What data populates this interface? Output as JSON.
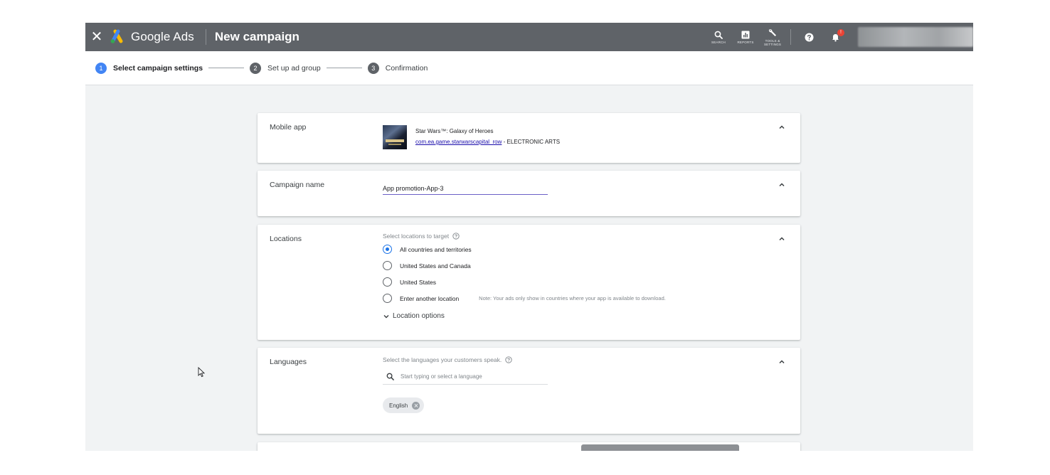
{
  "header": {
    "brand": "Google Ads",
    "page_title": "New campaign",
    "tools": [
      {
        "label": "SEARCH",
        "icon": "search-icon"
      },
      {
        "label": "REPORTS",
        "icon": "reports-icon"
      },
      {
        "label": "TOOLS & SETTINGS",
        "icon": "wrench-icon"
      }
    ],
    "notification_badge": "!"
  },
  "stepper": {
    "steps": [
      {
        "num": "1",
        "label": "Select campaign settings",
        "active": true
      },
      {
        "num": "2",
        "label": "Set up ad group",
        "active": false
      },
      {
        "num": "3",
        "label": "Confirmation",
        "active": false
      }
    ]
  },
  "mobile_app": {
    "label": "Mobile app",
    "app_name": "Star Wars™: Galaxy of Heroes",
    "package_link": "com.ea.game.starwarscapital_row",
    "publisher": " - ELECTRONIC ARTS"
  },
  "campaign_name": {
    "label": "Campaign name",
    "value": "App promotion-App-3"
  },
  "locations": {
    "label": "Locations",
    "hint": "Select locations to target",
    "options": [
      {
        "label": "All countries and territories",
        "checked": true
      },
      {
        "label": "United States and Canada",
        "checked": false
      },
      {
        "label": "United States",
        "checked": false
      },
      {
        "label": "Enter another location",
        "checked": false
      }
    ],
    "note": "Note: Your ads only show in countries where your app is available to download.",
    "more_options": "Location options"
  },
  "languages": {
    "label": "Languages",
    "hint": "Select the languages your customers speak.",
    "search_placeholder": "Start typing or select a language",
    "selected": [
      "English"
    ]
  },
  "colors": {
    "topbar": "#5f6368",
    "accent": "#4285f4",
    "background": "#f1f3f4",
    "notification": "#ea4335"
  }
}
